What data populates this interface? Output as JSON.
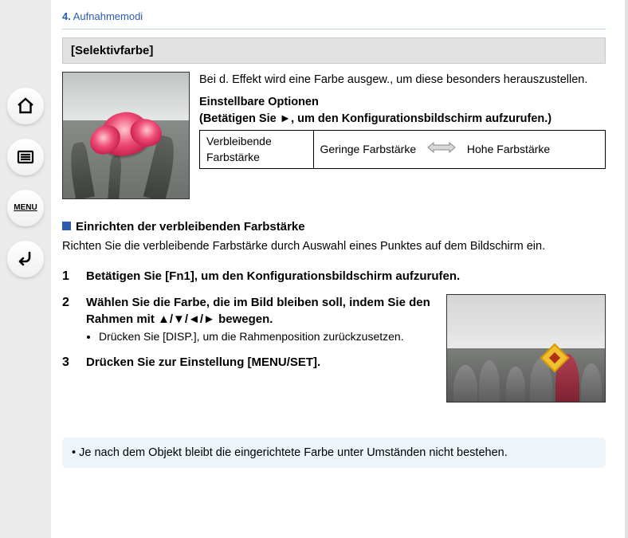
{
  "breadcrumb": {
    "number": "4.",
    "title": "Aufnahmemodi"
  },
  "section": {
    "title": "[Selektivfarbe]"
  },
  "intro": {
    "text": "Bei d. Effekt wird eine Farbe ausgew., um diese besonders herauszustellen.",
    "options_heading": "Einstellbare Optionen",
    "options_sub": "(Betätigen Sie ►, um den Konfigurationsbildschirm aufzurufen.)",
    "table": {
      "label": "Verbleibende Farbstärke",
      "low": "Geringe Farbstärke",
      "high": "Hohe Farbstärke"
    }
  },
  "subsection": {
    "heading": "Einrichten der verbleibenden Farbstärke",
    "body": "Richten Sie die verbleibende Farbstärke durch Auswahl eines Punktes auf dem Bildschirm ein."
  },
  "steps": [
    {
      "main": "Betätigen Sie [Fn1], um den Konfigurationsbildschirm aufzurufen."
    },
    {
      "main": "Wählen Sie die Farbe, die im Bild bleiben soll, indem Sie den Rahmen mit ▲/▼/◄/► bewegen.",
      "sub": [
        "Drücken Sie [DISP.], um die Rahmenposition zurückzusetzen."
      ]
    },
    {
      "main": "Drücken Sie zur Einstellung [MENU/SET]."
    }
  ],
  "note": "Je nach dem Objekt bleibt die eingerichtete Farbe unter Umständen nicht bestehen.",
  "nav": {
    "home": "home-icon",
    "toc": "toc-icon",
    "menu_label": "MENU",
    "back": "back-icon"
  }
}
